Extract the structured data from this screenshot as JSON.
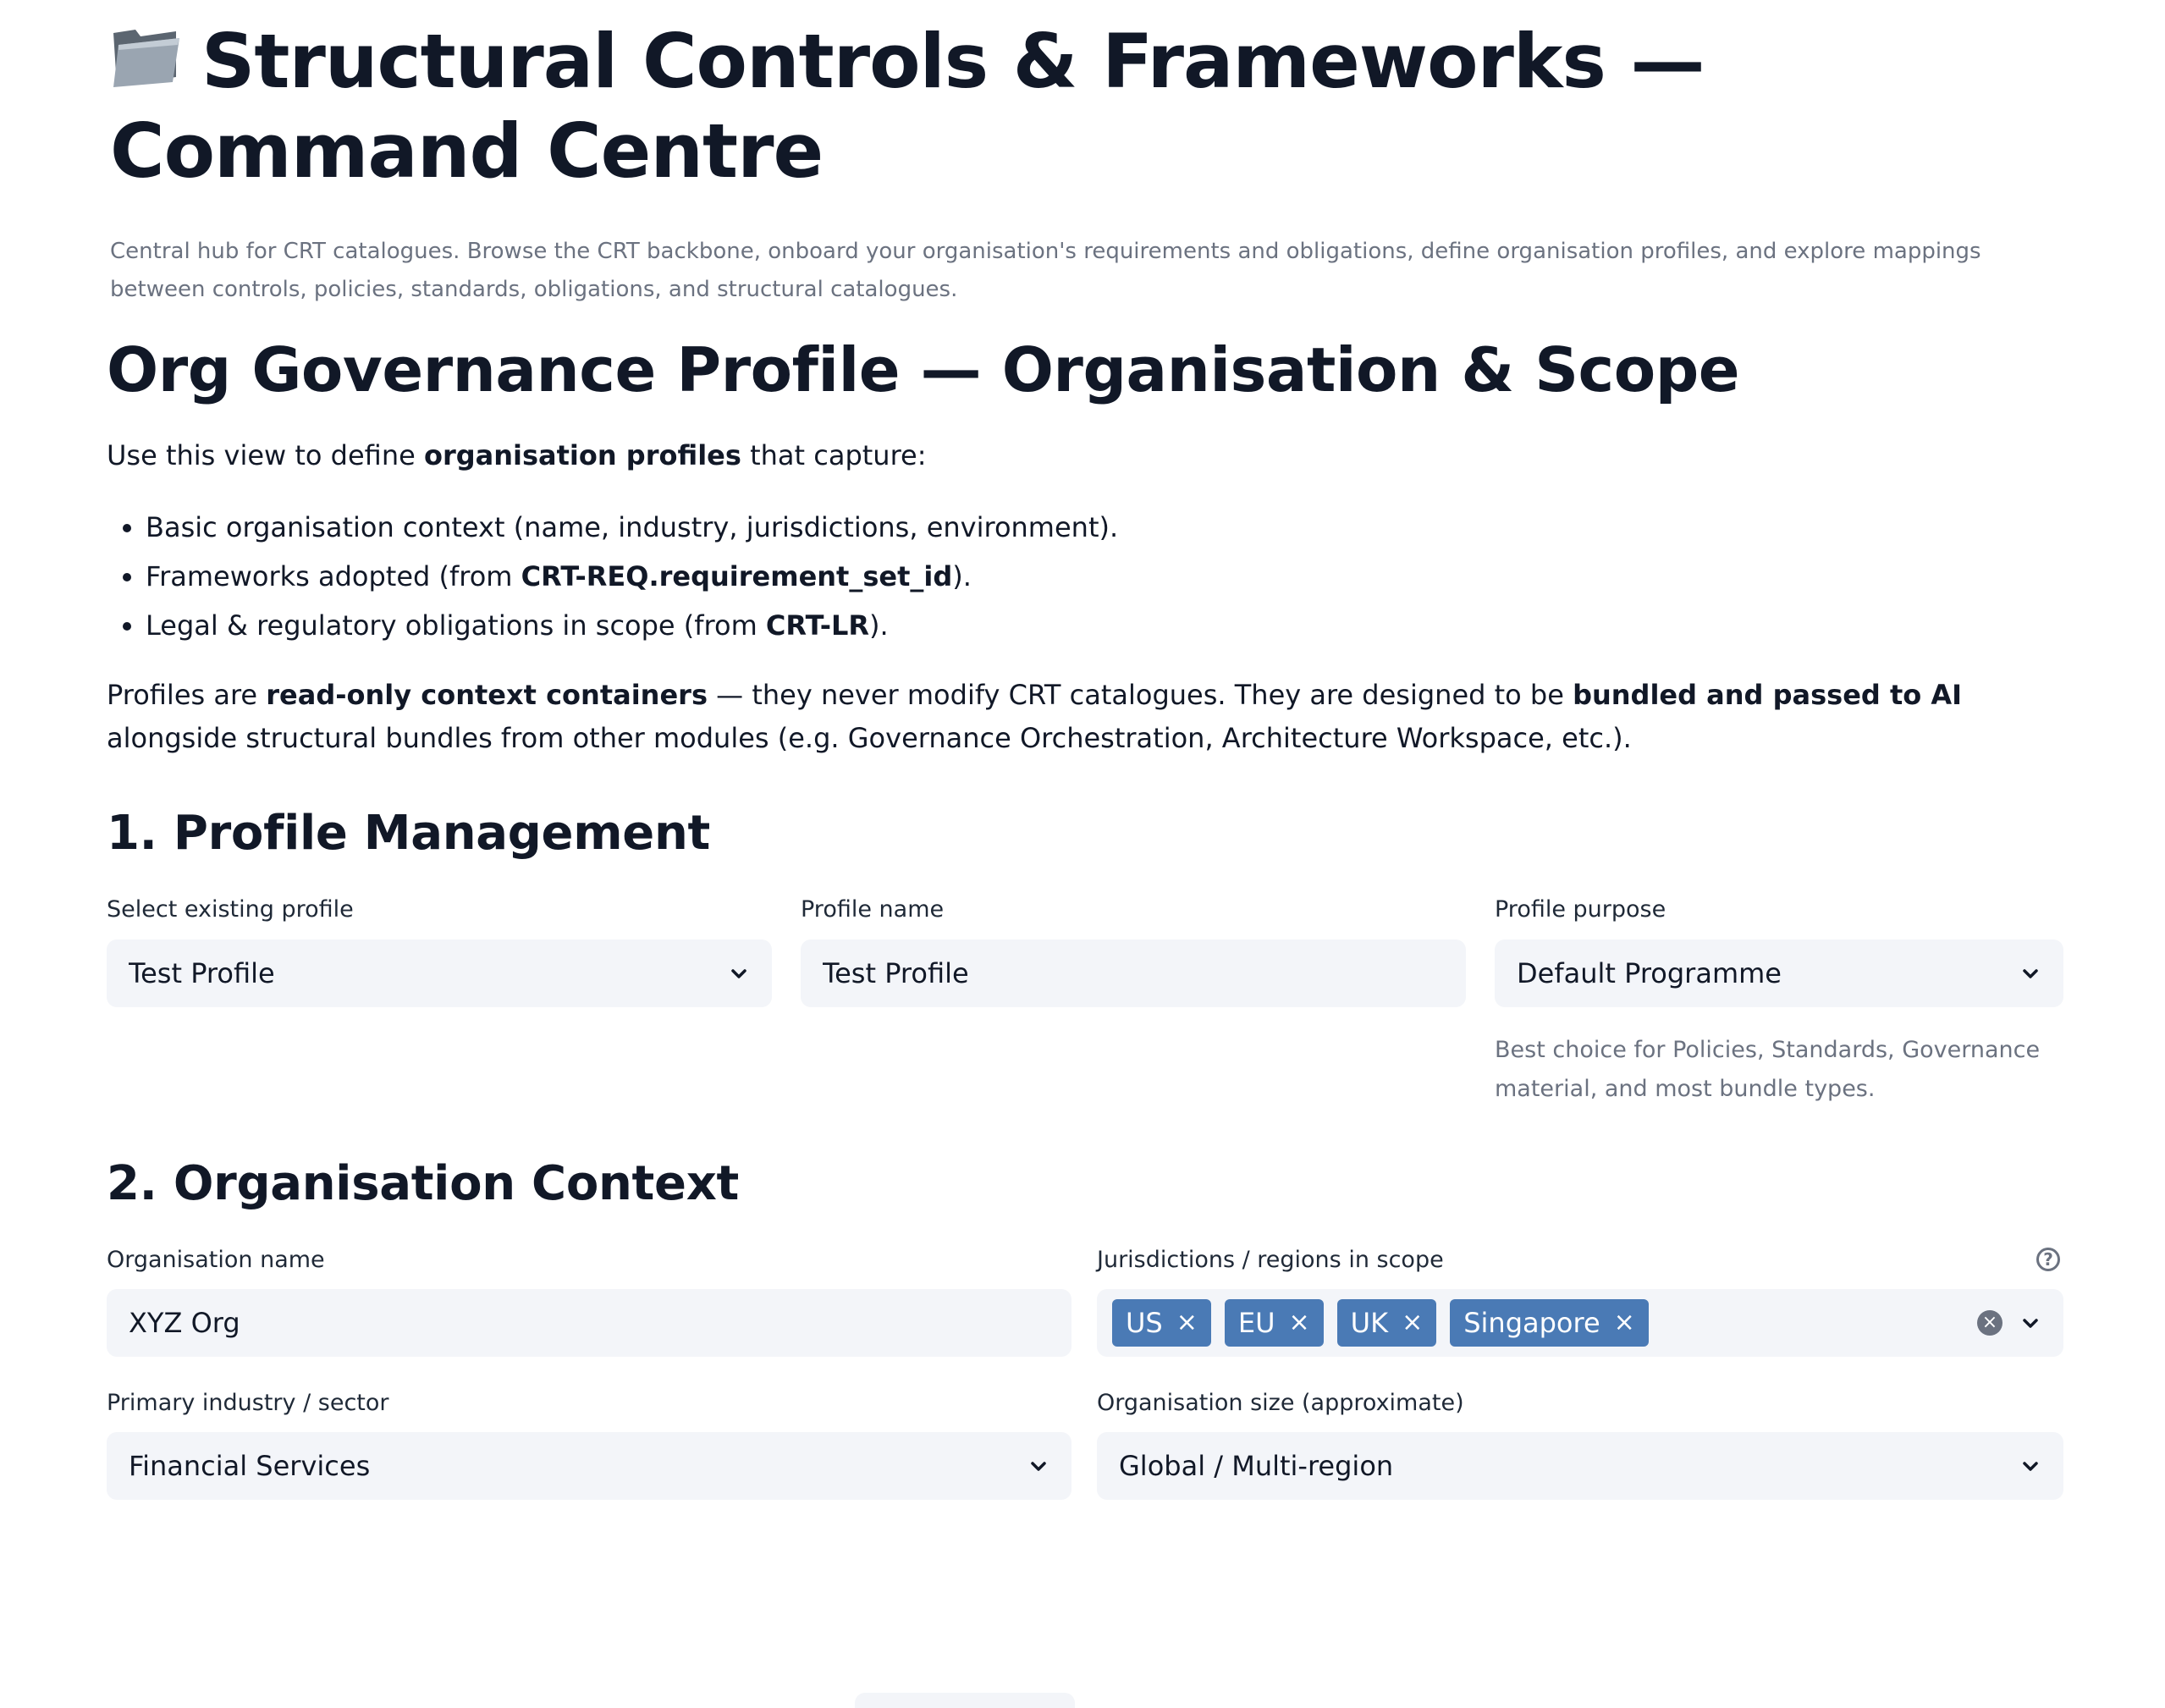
{
  "header": {
    "icon": "folder-icon",
    "title": "Structural Controls & Frameworks — Command Centre",
    "subtitle": "Central hub for CRT catalogues. Browse the CRT backbone, onboard your organisation's requirements and obligations, define organisation profiles, and explore mappings between controls, policies, standards, obligations, and structural catalogues."
  },
  "section": {
    "title": "Org Governance Profile — Organisation & Scope",
    "intro_prefix": "Use this view to define ",
    "intro_bold": "organisation profiles",
    "intro_suffix": " that capture:",
    "bullets": [
      {
        "text": "Basic organisation context (name, industry, jurisdictions, environment)."
      },
      {
        "prefix": "Frameworks adopted (from ",
        "bold": "CRT-REQ.requirement_set_id",
        "suffix": ")."
      },
      {
        "prefix": "Legal & regulatory obligations in scope (from ",
        "bold": "CRT-LR",
        "suffix": ")."
      }
    ],
    "para_1": "Profiles are ",
    "para_bold_1": "read-only context containers",
    "para_2": " — they never modify CRT catalogues. They are designed to be ",
    "para_bold_2": "bundled and passed to AI",
    "para_3": " alongside structural bundles from other modules (e.g. Governance Orchestration, Architecture Workspace, etc.)."
  },
  "profile_management": {
    "heading": "1. Profile Management",
    "select_label": "Select existing profile",
    "select_value": "Test Profile",
    "name_label": "Profile name",
    "name_value": "Test Profile",
    "purpose_label": "Profile purpose",
    "purpose_value": "Default Programme",
    "purpose_help": "Best choice for Policies, Standards, Governance material, and most bundle types."
  },
  "org_context": {
    "heading": "2. Organisation Context",
    "org_name_label": "Organisation name",
    "org_name_value": "XYZ Org",
    "jurisdictions_label": "Jurisdictions / regions in scope",
    "jurisdictions": [
      "US",
      "EU",
      "UK",
      "Singapore"
    ],
    "remove_glyph": "×",
    "clear_glyph": "×",
    "help_glyph": "?",
    "industry_label": "Primary industry / sector",
    "industry_value": "Financial Services",
    "size_label": "Organisation size (approximate)",
    "size_value": "Global / Multi-region"
  },
  "colors": {
    "tag_background": "#4a7ab5",
    "field_background": "#f3f5f9",
    "muted_text": "#6b7280",
    "heading_text": "#111827"
  }
}
